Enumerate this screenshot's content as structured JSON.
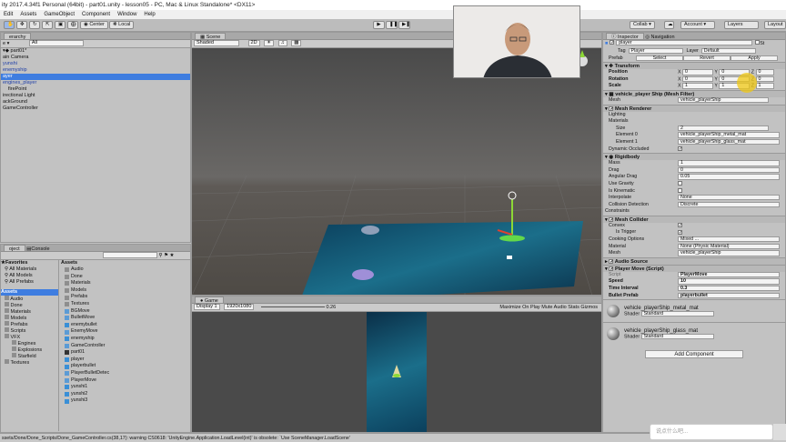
{
  "window": {
    "title": "ity 2017.4.34f1 Personal (64bit) - part01.unity - lesson05 - PC, Mac & Linux Standalone* <DX11>"
  },
  "menu": [
    "Edit",
    "Assets",
    "GameObject",
    "Component",
    "Window",
    "Help"
  ],
  "toolbar": {
    "center": "Center",
    "local": "Local",
    "collab": "Collab ▾",
    "account": "Account ▾",
    "layers": "Layers",
    "layout": "Layout"
  },
  "hierarchy": {
    "tab": "erarchy",
    "create": "e ▾",
    "search": "All",
    "scene": "part01*",
    "items": [
      {
        "label": "ain Camera",
        "indent": 0,
        "state": "normal"
      },
      {
        "label": "yunshi",
        "indent": 0,
        "state": "blue"
      },
      {
        "label": "enemyship",
        "indent": 0,
        "state": "blue"
      },
      {
        "label": "ayer",
        "indent": 0,
        "state": "selected"
      },
      {
        "label": "engines_player",
        "indent": 0,
        "state": "blue"
      },
      {
        "label": "firePoint",
        "indent": 1,
        "state": "normal"
      },
      {
        "label": "irectional Light",
        "indent": 0,
        "state": "normal"
      },
      {
        "label": "ackGround",
        "indent": 0,
        "state": "normal"
      },
      {
        "label": "GameController",
        "indent": 0,
        "state": "normal"
      }
    ]
  },
  "scene": {
    "tab": "Scene",
    "shading": "Shaded",
    "mode": "2D"
  },
  "game": {
    "tab": "Game",
    "display": "Display 1",
    "resolution": "1920x1080",
    "scale": "0.26",
    "buttons": [
      "Maximize On Play",
      "Mute Audio",
      "Stats",
      "Gizmos"
    ]
  },
  "project": {
    "tabs": [
      "oject",
      "Console"
    ],
    "favorites": {
      "header": "Favorites",
      "items": [
        "All Materials",
        "All Models",
        "All Prefabs"
      ]
    },
    "assets_tree": {
      "header": "Assets",
      "items": [
        "Audio",
        "Done",
        "Materials",
        "Models",
        "Prefabs",
        "Scripts",
        "VFX",
        "Engines",
        "Explosions",
        "Starfield",
        "Textures"
      ]
    },
    "list_header": "Assets",
    "assets": [
      {
        "name": "Audio",
        "kind": "folder"
      },
      {
        "name": "Done",
        "kind": "folder"
      },
      {
        "name": "Materials",
        "kind": "folder"
      },
      {
        "name": "Models",
        "kind": "folder"
      },
      {
        "name": "Prefabs",
        "kind": "folder"
      },
      {
        "name": "Textures",
        "kind": "folder"
      },
      {
        "name": "BGMove",
        "kind": "script"
      },
      {
        "name": "BulletMove",
        "kind": "script"
      },
      {
        "name": "enemybullet",
        "kind": "prefab"
      },
      {
        "name": "EnemyMove",
        "kind": "script"
      },
      {
        "name": "enemyship",
        "kind": "prefab"
      },
      {
        "name": "GameController",
        "kind": "script"
      },
      {
        "name": "part01",
        "kind": "scene"
      },
      {
        "name": "player",
        "kind": "prefab"
      },
      {
        "name": "playerbullet",
        "kind": "prefab"
      },
      {
        "name": "PlayerBulletDetec",
        "kind": "script"
      },
      {
        "name": "PlayerMove",
        "kind": "script"
      },
      {
        "name": "yunshi1",
        "kind": "prefab"
      },
      {
        "name": "yunshi2",
        "kind": "prefab"
      },
      {
        "name": "yunshi3",
        "kind": "prefab"
      }
    ]
  },
  "inspector": {
    "tabs": [
      "Inspector",
      "Navigation"
    ],
    "name": "player",
    "static": "St",
    "tag_label": "Tag",
    "tag": "Player",
    "layer_label": "Layer",
    "layer": "Default",
    "prefab_label": "Prefab",
    "prefab_buttons": [
      "Select",
      "Revert",
      "Apply"
    ],
    "transform": {
      "title": "Transform",
      "rows": [
        {
          "label": "Position",
          "x": "0",
          "y": "0",
          "z": "0"
        },
        {
          "label": "Rotation",
          "x": "0",
          "y": "0",
          "z": "0"
        },
        {
          "label": "Scale",
          "x": "1",
          "y": "1",
          "z": "1"
        }
      ]
    },
    "mesh_filter": {
      "title": "vehicle_player Ship (Mesh Filter)",
      "mesh_label": "Mesh",
      "mesh": "vehicle_playerShip"
    },
    "mesh_renderer": {
      "title": "Mesh Renderer",
      "lighting": "Lighting",
      "materials": "Materials",
      "size_label": "Size",
      "size": "2",
      "elements": [
        {
          "label": "Element 0",
          "value": "vehicle_playerShip_metal_mat"
        },
        {
          "label": "Element 1",
          "value": "vehicle_playerShip_glass_mat"
        }
      ],
      "dyn_label": "Dynamic Occluded"
    },
    "rigidbody": {
      "title": "Rigidbody",
      "rows": [
        {
          "label": "Mass",
          "value": "1",
          "type": "field"
        },
        {
          "label": "Drag",
          "value": "0",
          "type": "field"
        },
        {
          "label": "Angular Drag",
          "value": "0.05",
          "type": "field"
        },
        {
          "label": "Use Gravity",
          "value": "",
          "type": "check"
        },
        {
          "label": "Is Kinematic",
          "value": "",
          "type": "check"
        },
        {
          "label": "Interpolate",
          "value": "None",
          "type": "field"
        },
        {
          "label": "Collision Detection",
          "value": "Discrete",
          "type": "field"
        }
      ],
      "constraints": "Constraints"
    },
    "mesh_collider": {
      "title": "Mesh Collider",
      "rows": [
        {
          "label": "Convex",
          "value": "✓",
          "type": "check"
        },
        {
          "label": "Is Trigger",
          "value": "✓",
          "type": "check",
          "indent": true
        },
        {
          "label": "Cooking Options",
          "value": "Mixed ...",
          "type": "field"
        },
        {
          "label": "Material",
          "value": "None (Physic Material)",
          "type": "field"
        },
        {
          "label": "Mesh",
          "value": "vehicle_playerShip",
          "type": "field"
        }
      ]
    },
    "audio_source": {
      "title": "Audio Source"
    },
    "player_move": {
      "title": "Player Move (Script)",
      "rows": [
        {
          "label": "Script",
          "value": "PlayerMove"
        },
        {
          "label": "Speed",
          "value": "10"
        },
        {
          "label": "Time Interval",
          "value": "0.3"
        },
        {
          "label": "Bullet Prefab",
          "value": "playerbullet"
        }
      ]
    },
    "materials": [
      {
        "name": "vehicle_playerShip_metal_mat",
        "shader_label": "Shader",
        "shader": "Standard"
      },
      {
        "name": "vehicle_playerShip_glass_mat",
        "shader_label": "Shader",
        "shader": "Standard"
      }
    ],
    "add_component": "Add Component"
  },
  "status": {
    "text": "ssets/Done/Done_Scripts/Done_GameController.cs(38,17): warning CS0618: 'UnityEngine.Application.LoadLevel(int)' is obsolete: `Use SceneManager.LoadScene'"
  },
  "overlay": {
    "search_placeholder": "说点什么吧..."
  }
}
